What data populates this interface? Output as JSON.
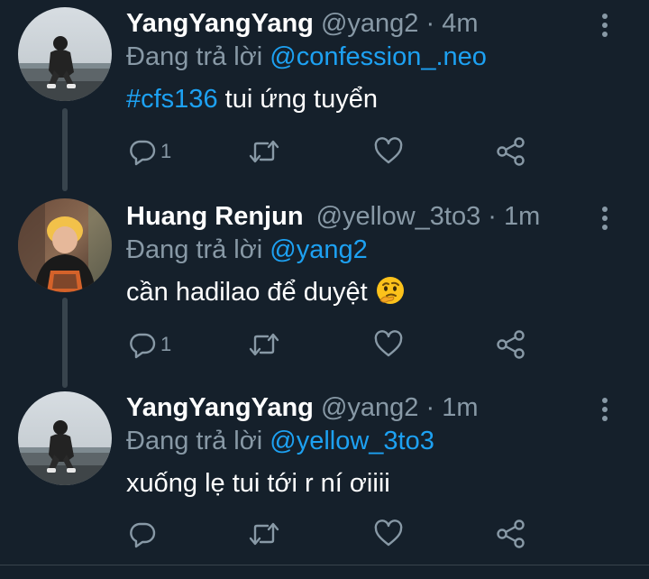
{
  "colors": {
    "background": "#15202b",
    "text_primary": "#ffffff",
    "text_secondary": "#8899a6",
    "accent": "#1da1f2",
    "thread_line": "#38444d"
  },
  "tweets": [
    {
      "display_name": "YangYangYang",
      "handle": "@yang2",
      "separator": "·",
      "time": "4m",
      "reply_prefix": "Đang trả lời",
      "reply_to": "@confession_.neo",
      "text_hashtag": "#cfs136",
      "text_body": " tui ứng tuyển",
      "reply_count": "1",
      "icons": [
        "reply-icon",
        "retweet-icon",
        "like-icon",
        "share-icon",
        "more-icon"
      ]
    },
    {
      "display_name": "Huang Renjun",
      "handle": "@yellow_3to3",
      "separator": "·",
      "time": "1m",
      "reply_prefix": "Đang trả lời",
      "reply_to": "@yang2",
      "text_body": "cần hadilao để duyệt",
      "emoji": "thinking-face-emoji",
      "reply_count": "1",
      "icons": [
        "reply-icon",
        "retweet-icon",
        "like-icon",
        "share-icon",
        "more-icon"
      ]
    },
    {
      "display_name": "YangYangYang",
      "handle": "@yang2",
      "separator": "·",
      "time": "1m",
      "reply_prefix": "Đang trả lời",
      "reply_to": "@yellow_3to3",
      "text_body": "xuống lẹ tui tới r ní ơiiii",
      "reply_count": "",
      "icons": [
        "reply-icon",
        "retweet-icon",
        "like-icon",
        "share-icon",
        "more-icon"
      ]
    }
  ]
}
